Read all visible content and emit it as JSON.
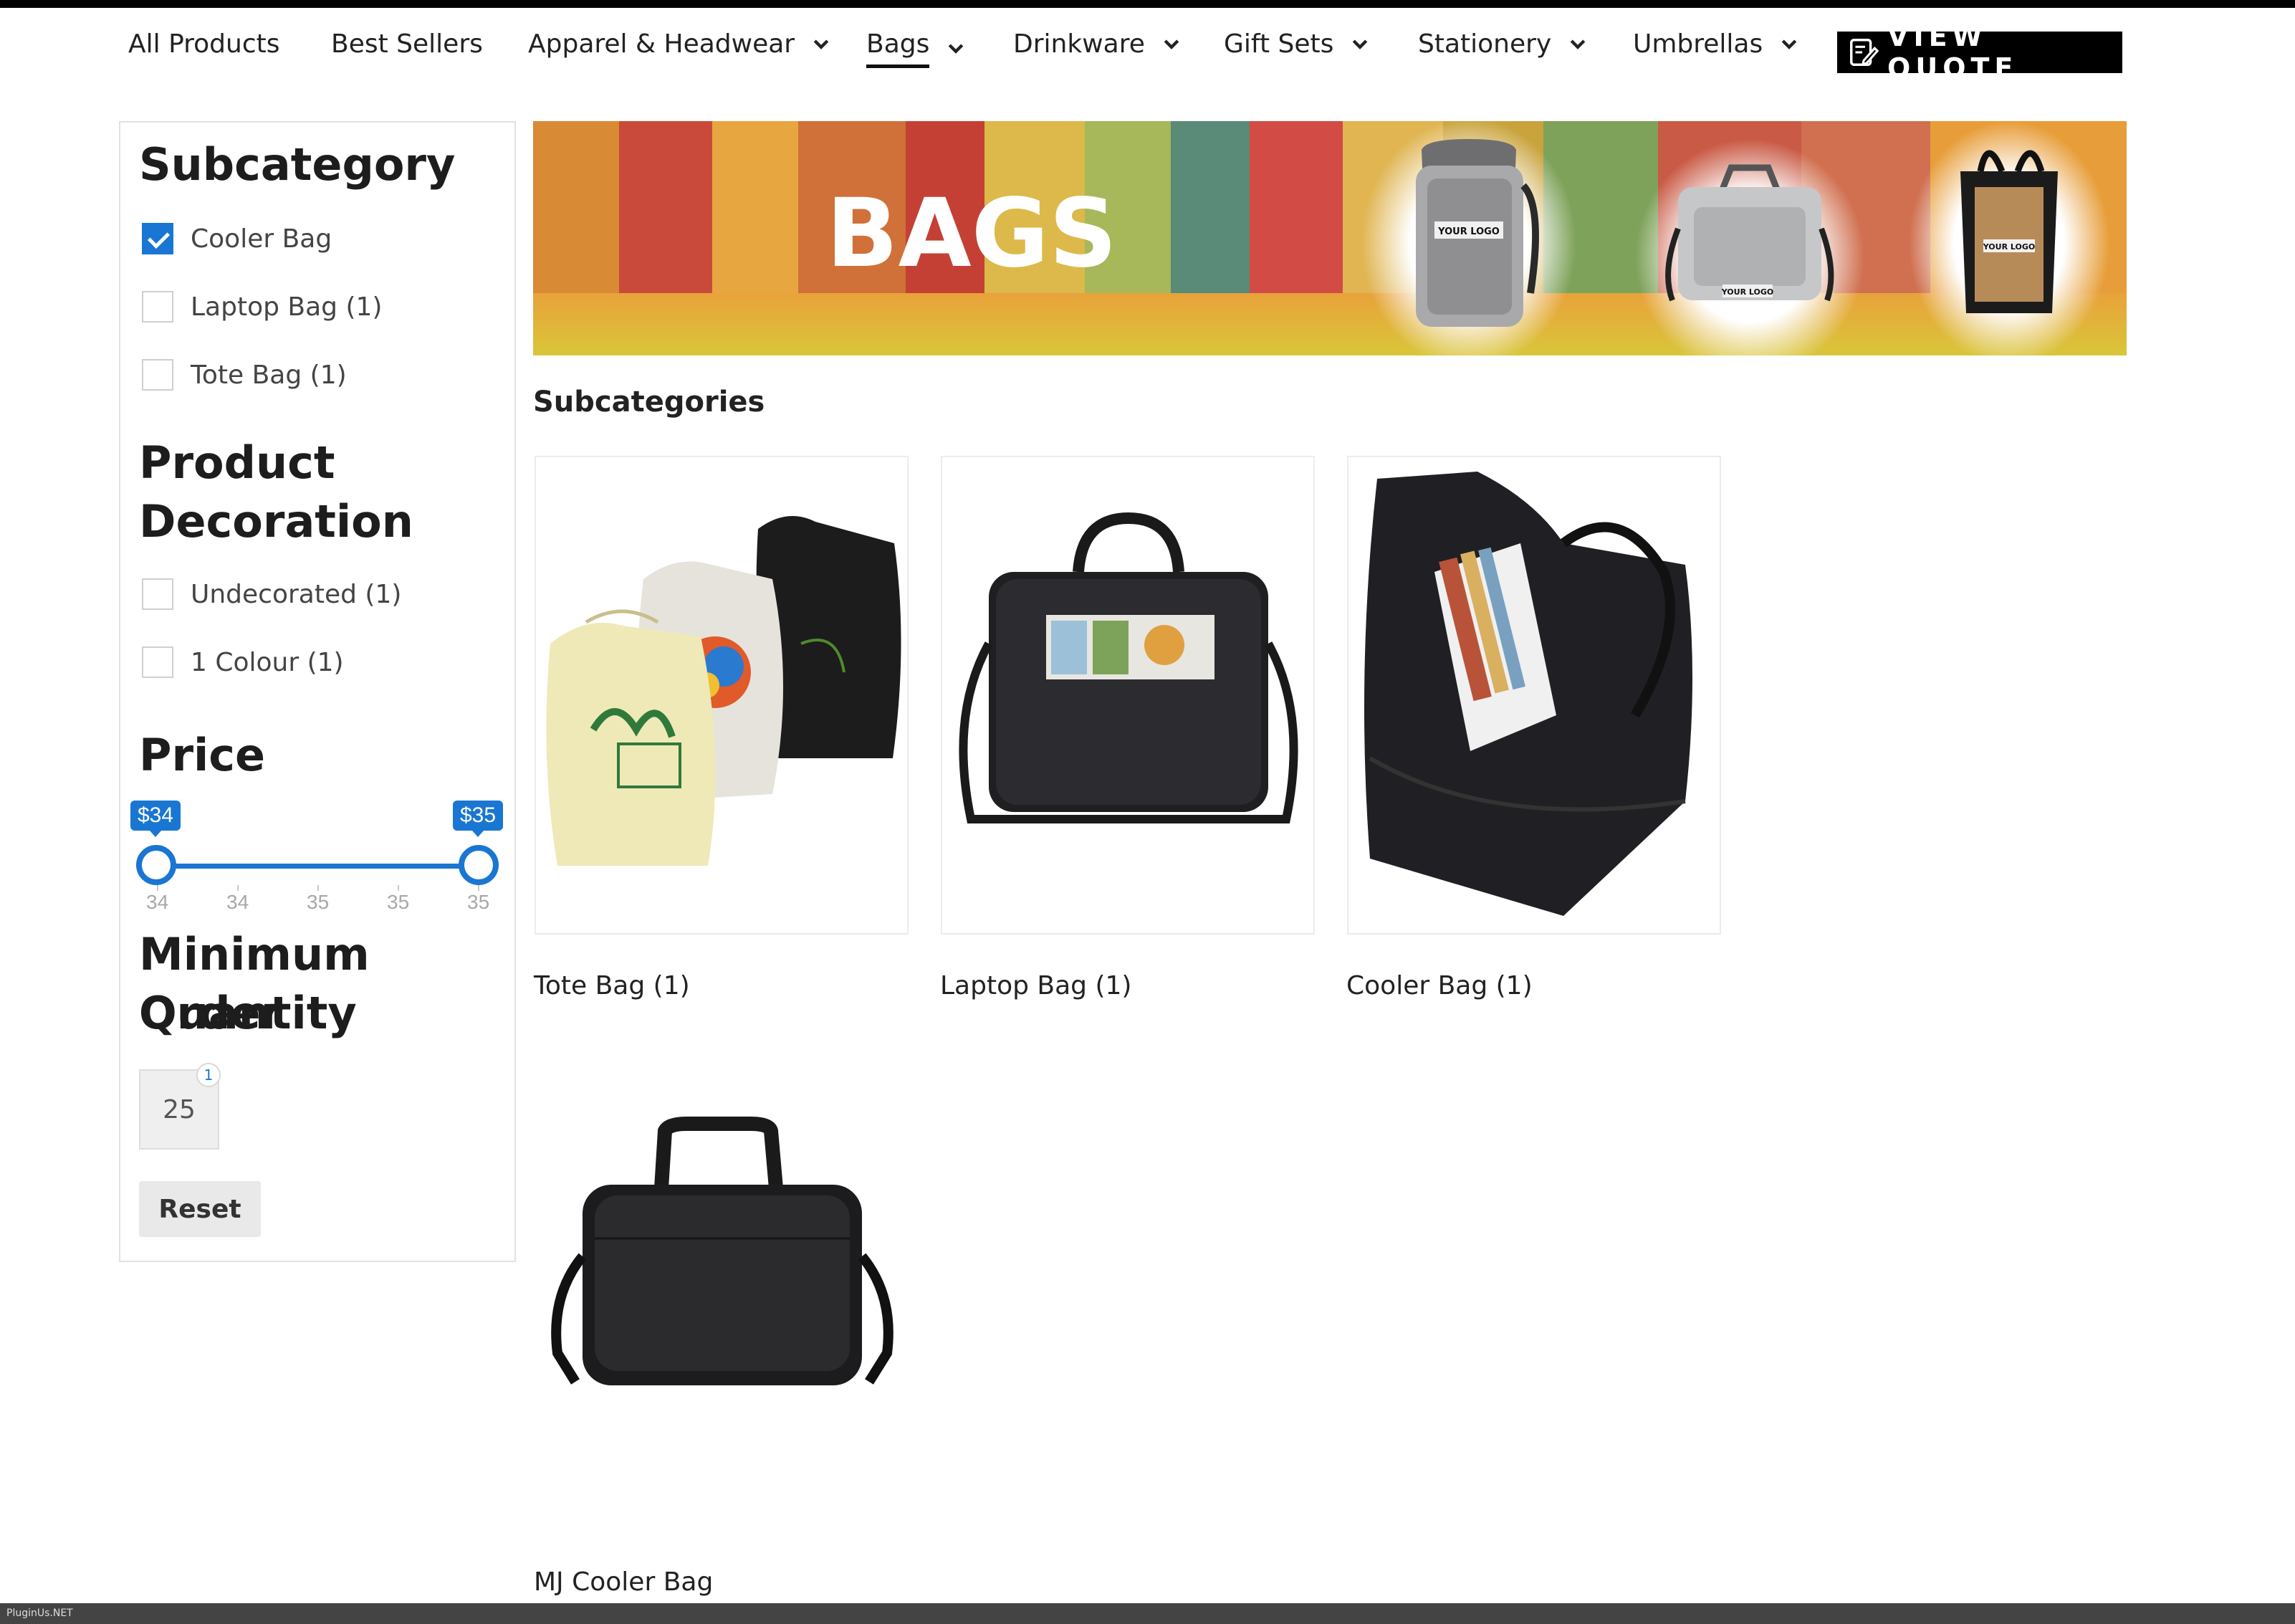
{
  "nav": {
    "items": [
      {
        "label": "All Products",
        "dropdown": false,
        "active": false
      },
      {
        "label": "Best Sellers",
        "dropdown": false,
        "active": false
      },
      {
        "label": "Apparel & Headwear",
        "dropdown": true,
        "active": false
      },
      {
        "label": "Bags",
        "dropdown": true,
        "active": true
      },
      {
        "label": "Drinkware",
        "dropdown": true,
        "active": false
      },
      {
        "label": "Gift Sets",
        "dropdown": true,
        "active": false
      },
      {
        "label": "Stationery",
        "dropdown": true,
        "active": false
      },
      {
        "label": "Umbrellas",
        "dropdown": true,
        "active": false
      }
    ],
    "view_quote": "VIEW QUOTE"
  },
  "sidebar": {
    "subcategory": {
      "title": "Subcategory",
      "options": [
        {
          "label": "Cooler Bag",
          "checked": true
        },
        {
          "label": "Laptop Bag (1)",
          "checked": false
        },
        {
          "label": "Tote Bag (1)",
          "checked": false
        }
      ]
    },
    "decoration": {
      "title_line1": "Product",
      "title_line2": "Decoration",
      "options": [
        {
          "label": "Undecorated (1)",
          "checked": false
        },
        {
          "label": "1 Colour (1)",
          "checked": false
        }
      ]
    },
    "price": {
      "title": "Price",
      "min_label": "$34",
      "max_label": "$35",
      "tick_labels": [
        "34",
        "34",
        "35",
        "35",
        "35"
      ]
    },
    "moq": {
      "title_line1": "Minimum Order",
      "title_line2": "Quantity",
      "value": "25",
      "badge": "1"
    },
    "reset_label": "Reset"
  },
  "banner": {
    "text": "BAGS",
    "logo_text": "YOUR LOGO"
  },
  "main": {
    "section_title": "Subcategories",
    "cards": [
      {
        "label": "Tote Bag (1)"
      },
      {
        "label": "Laptop Bag (1)"
      },
      {
        "label": "Cooler Bag (1)"
      }
    ],
    "product": {
      "label": "MJ Cooler Bag"
    }
  },
  "footer": {
    "text": "PluginUs.NET"
  },
  "colors": {
    "accent": "#1976d2",
    "nav_text": "#222222",
    "border": "#e2e2e2"
  }
}
